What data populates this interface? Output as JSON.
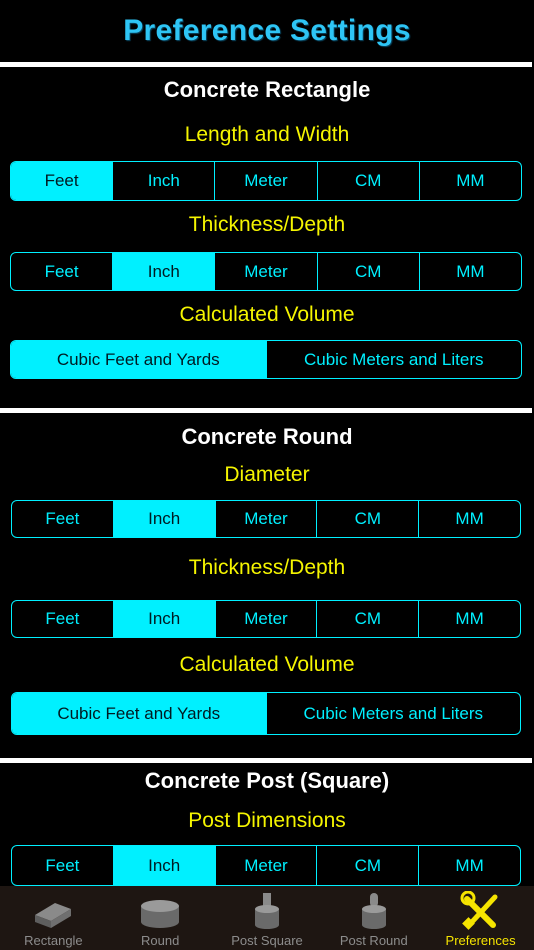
{
  "header": {
    "title": "Preference Settings"
  },
  "sections": [
    {
      "title": "Concrete Rectangle",
      "groups": [
        {
          "label": "Length and Width",
          "options": [
            "Feet",
            "Inch",
            "Meter",
            "CM",
            "MM"
          ],
          "selected": 0
        },
        {
          "label": "Thickness/Depth",
          "options": [
            "Feet",
            "Inch",
            "Meter",
            "CM",
            "MM"
          ],
          "selected": 1
        },
        {
          "label": "Calculated Volume",
          "options": [
            "Cubic Feet and Yards",
            "Cubic Meters and Liters"
          ],
          "selected": 0
        }
      ]
    },
    {
      "title": "Concrete Round",
      "groups": [
        {
          "label": "Diameter",
          "options": [
            "Feet",
            "Inch",
            "Meter",
            "CM",
            "MM"
          ],
          "selected": 1
        },
        {
          "label": "Thickness/Depth",
          "options": [
            "Feet",
            "Inch",
            "Meter",
            "CM",
            "MM"
          ],
          "selected": 1
        },
        {
          "label": "Calculated Volume",
          "options": [
            "Cubic Feet and Yards",
            "Cubic Meters and Liters"
          ],
          "selected": 0
        }
      ]
    },
    {
      "title": "Concrete Post (Square)",
      "groups": [
        {
          "label": "Post Dimensions",
          "options": [
            "Feet",
            "Inch",
            "Meter",
            "CM",
            "MM"
          ],
          "selected": 1
        }
      ]
    }
  ],
  "tabbar": {
    "active": 4,
    "tabs": [
      {
        "label": "Rectangle",
        "icon": "slab-icon"
      },
      {
        "label": "Round",
        "icon": "cylinder-icon"
      },
      {
        "label": "Post Square",
        "icon": "post-square-icon"
      },
      {
        "label": "Post Round",
        "icon": "post-round-icon"
      },
      {
        "label": "Preferences",
        "icon": "tools-icon"
      }
    ]
  },
  "colors": {
    "accent": "#00f0ff",
    "title": "#2ec5f5",
    "label": "#f5f500",
    "active_tab": "#f5e400",
    "tabbar_bg": "#1e1612"
  }
}
